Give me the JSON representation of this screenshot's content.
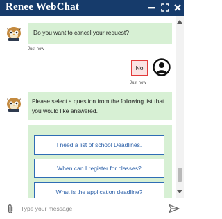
{
  "window": {
    "title": "Renee WebChat",
    "controls": {
      "minimize_icon": "minimize-icon",
      "maximize_icon": "maximize-icon",
      "close_icon": "close-icon"
    }
  },
  "messages": [
    {
      "from": "bot",
      "text": "Do you want to cancel your request?",
      "time": "Just now"
    },
    {
      "from": "user",
      "text": "No",
      "time": "Just now"
    },
    {
      "from": "bot",
      "text": "Please select a question from the following list that you would like answered."
    }
  ],
  "suggestions": [
    "I need a list of school Deadlines.",
    "When can I register for classes?",
    "What is the application deadline?"
  ],
  "composer": {
    "placeholder": "Type your message",
    "attach_icon": "paperclip-icon",
    "send_icon": "send-icon"
  },
  "colors": {
    "title_bar": "#163b6b",
    "bot_bubble": "#d7f0d4",
    "user_bubble_border": "#e23b3b",
    "suggestion_border": "#2f6db5",
    "suggestion_text": "#2a5fa8"
  }
}
